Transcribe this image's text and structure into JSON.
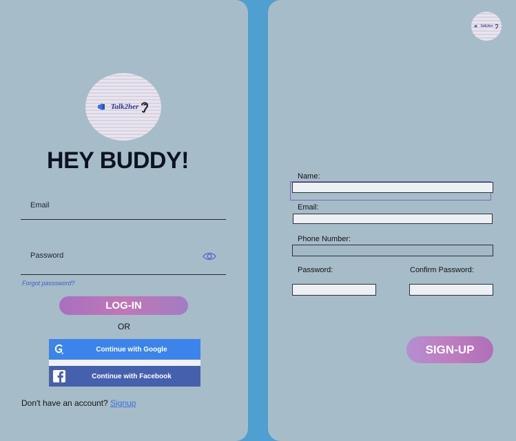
{
  "login": {
    "logo_text": "Talk2her",
    "heading": "HEY BUDDY!",
    "email_label": "Email",
    "password_label": "Password",
    "forgot_label": "Forgot passsword?",
    "login_button": "LOG-IN",
    "or_text": "OR",
    "google_button": "Continue with Google",
    "facebook_button": "Continue with Facebook",
    "no_account_text": "Don't have an account?",
    "signup_link": "Signup"
  },
  "signup": {
    "logo_text": "Talk2her",
    "name_label": "Name:",
    "email_label": "Email:",
    "phone_label": "Phone Number:",
    "password_label": "Password:",
    "confirm_label": "Confirm Password:",
    "signup_button": "SIGN-UP"
  },
  "colors": {
    "background": "#4f9fd0",
    "panel": "#a7bcc9",
    "accent": "#c077b6",
    "google": "#3c84eb",
    "facebook": "#4560ad",
    "link": "#3a6fd6"
  }
}
